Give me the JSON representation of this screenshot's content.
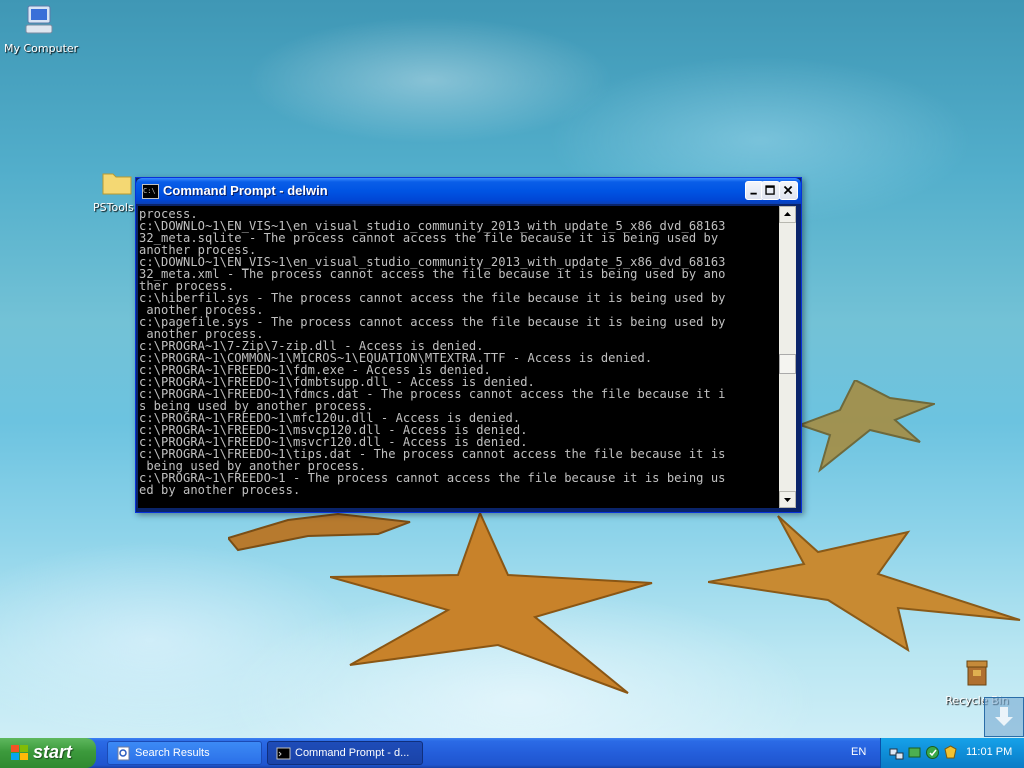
{
  "desktop": {
    "icons": [
      {
        "label": "My Computer",
        "icon": "my-computer-icon"
      },
      {
        "label": "PSTools",
        "icon": "folder-icon"
      },
      {
        "label": "Recycle Bin",
        "icon": "recycle-bin-icon"
      }
    ]
  },
  "window": {
    "title": "Command Prompt - delwin",
    "icon_text": "C:\\",
    "console_lines": [
      "process.",
      "c:\\DOWNLO~1\\EN_VIS~1\\en_visual_studio_community_2013_with_update_5_x86_dvd_68163",
      "32_meta.sqlite - The process cannot access the file because it is being used by",
      "another process.",
      "c:\\DOWNLO~1\\EN_VIS~1\\en_visual_studio_community_2013_with_update_5_x86_dvd_68163",
      "32_meta.xml - The process cannot access the file because it is being used by ano",
      "ther process.",
      "c:\\hiberfil.sys - The process cannot access the file because it is being used by",
      " another process.",
      "c:\\pagefile.sys - The process cannot access the file because it is being used by",
      " another process.",
      "c:\\PROGRA~1\\7-Zip\\7-zip.dll - Access is denied.",
      "c:\\PROGRA~1\\COMMON~1\\MICROS~1\\EQUATION\\MTEXTRA.TTF - Access is denied.",
      "c:\\PROGRA~1\\FREEDO~1\\fdm.exe - Access is denied.",
      "c:\\PROGRA~1\\FREEDO~1\\fdmbtsupp.dll - Access is denied.",
      "c:\\PROGRA~1\\FREEDO~1\\fdmcs.dat - The process cannot access the file because it i",
      "s being used by another process.",
      "c:\\PROGRA~1\\FREEDO~1\\mfc120u.dll - Access is denied.",
      "c:\\PROGRA~1\\FREEDO~1\\msvcp120.dll - Access is denied.",
      "c:\\PROGRA~1\\FREEDO~1\\msvcr120.dll - Access is denied.",
      "c:\\PROGRA~1\\FREEDO~1\\tips.dat - The process cannot access the file because it is",
      " being used by another process.",
      "c:\\PROGRA~1\\FREEDO~1 - The process cannot access the file because it is being us",
      "ed by another process.",
      "_"
    ]
  },
  "taskbar": {
    "start_label": "start",
    "tasks": [
      {
        "label": "Search Results",
        "icon": "search-results-icon"
      },
      {
        "label": "Command Prompt - d...",
        "icon": "command-prompt-icon"
      }
    ],
    "language": "EN",
    "clock": "11:01 PM"
  },
  "colors": {
    "console_bg": "#000000",
    "console_fg": "#c0c0c0",
    "titlebar": "#0054e3",
    "taskbar": "#245edb",
    "start_green": "#3c9a3c"
  }
}
